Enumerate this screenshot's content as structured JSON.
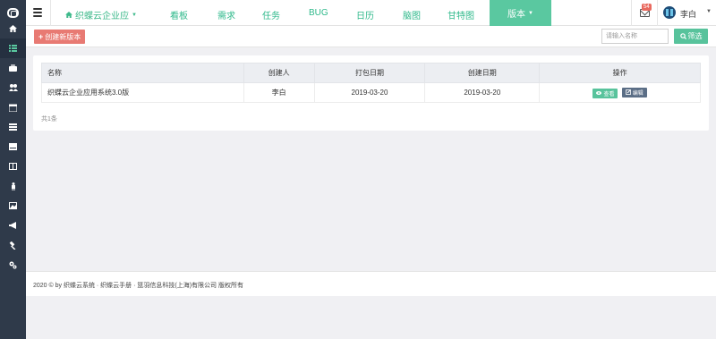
{
  "sidebar": {
    "items": [
      {
        "icon": "home-icon"
      },
      {
        "icon": "list-icon",
        "active": true
      },
      {
        "icon": "briefcase-icon"
      },
      {
        "icon": "users-icon"
      },
      {
        "icon": "calendar-icon"
      },
      {
        "icon": "server-icon"
      },
      {
        "icon": "book-icon"
      },
      {
        "icon": "columns-icon"
      },
      {
        "icon": "person-icon"
      },
      {
        "icon": "image-icon"
      },
      {
        "icon": "bullhorn-icon"
      },
      {
        "icon": "gavel-icon"
      },
      {
        "icon": "cogs-icon"
      }
    ]
  },
  "header": {
    "project": "织蝶云企业应",
    "nav": [
      "看板",
      "需求",
      "任务",
      "BUG",
      "日历",
      "脑图",
      "甘特图"
    ],
    "active_nav": "版本",
    "mail_badge": "54",
    "user_name": "李白"
  },
  "toolbar": {
    "create_label": "创建新版本",
    "search_placeholder": "请输入名称",
    "filter_label": "筛选"
  },
  "table": {
    "headers": {
      "name": "名称",
      "creator": "创建人",
      "pack_date": "打包日期",
      "created_date": "创建日期",
      "actions": "操作"
    },
    "rows": [
      {
        "name": "织蝶云企业应用系统3.0版",
        "creator": "李白",
        "pack_date": "2019-03-20",
        "created_date": "2019-03-20",
        "view_label": "查看",
        "edit_label": "编辑"
      }
    ]
  },
  "total_count": "共1条",
  "footer": {
    "text": "2020 © by 织蝶云系统 · 织蝶云手册 · 篮羽信息科技(上海)有限公司 版权所有"
  },
  "colors": {
    "sidebar_bg": "#2f3a4a",
    "accent_green": "#5ac8a0",
    "create_button": "#e87a73",
    "edit_button": "#5b6e86"
  }
}
